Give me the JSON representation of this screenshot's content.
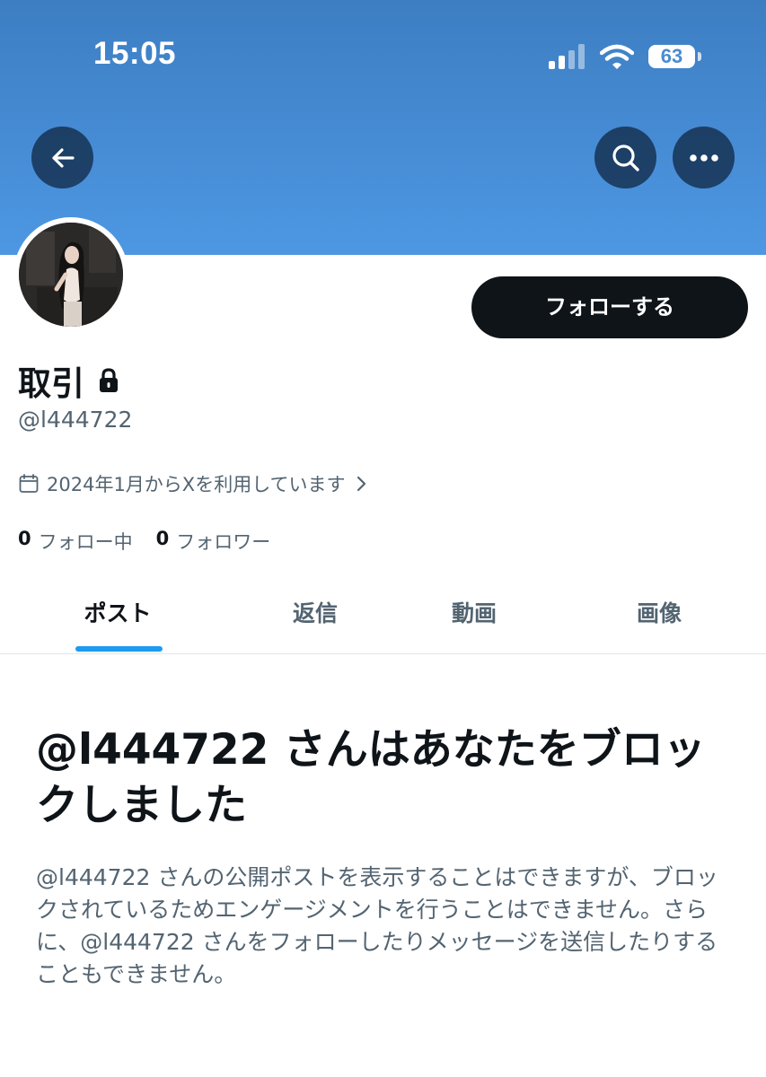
{
  "status_bar": {
    "time": "15:05",
    "battery": "63"
  },
  "header": {
    "back_icon": "arrow-left-icon",
    "search_icon": "search-icon",
    "more_icon": "more-horizontal-icon"
  },
  "profile": {
    "display_name": "取引",
    "handle": "@l444722",
    "joined_text": "2024年1月からXを利用しています",
    "follow_button": "フォローする",
    "following_count": "0",
    "following_label": "フォロー中",
    "followers_count": "0",
    "followers_label": "フォロワー"
  },
  "tabs": [
    {
      "label": "ポスト",
      "active": true
    },
    {
      "label": "返信",
      "active": false
    },
    {
      "label": "動画",
      "active": false
    },
    {
      "label": "画像",
      "active": false
    }
  ],
  "blocked_notice": {
    "title": "@l444722 さんはあなたをブロックしました",
    "description": "@l444722 さんの公開ポストを表示することはできますが、ブロックされているためエンゲージメントを行うことはできません。さらに、@l444722 さんをフォローしたりメッセージを送信したりすることもできません。"
  },
  "colors": {
    "banner": "#4a8fd8",
    "accent": "#1d9bf0",
    "text_primary": "#0f1419",
    "text_secondary": "#536471"
  }
}
